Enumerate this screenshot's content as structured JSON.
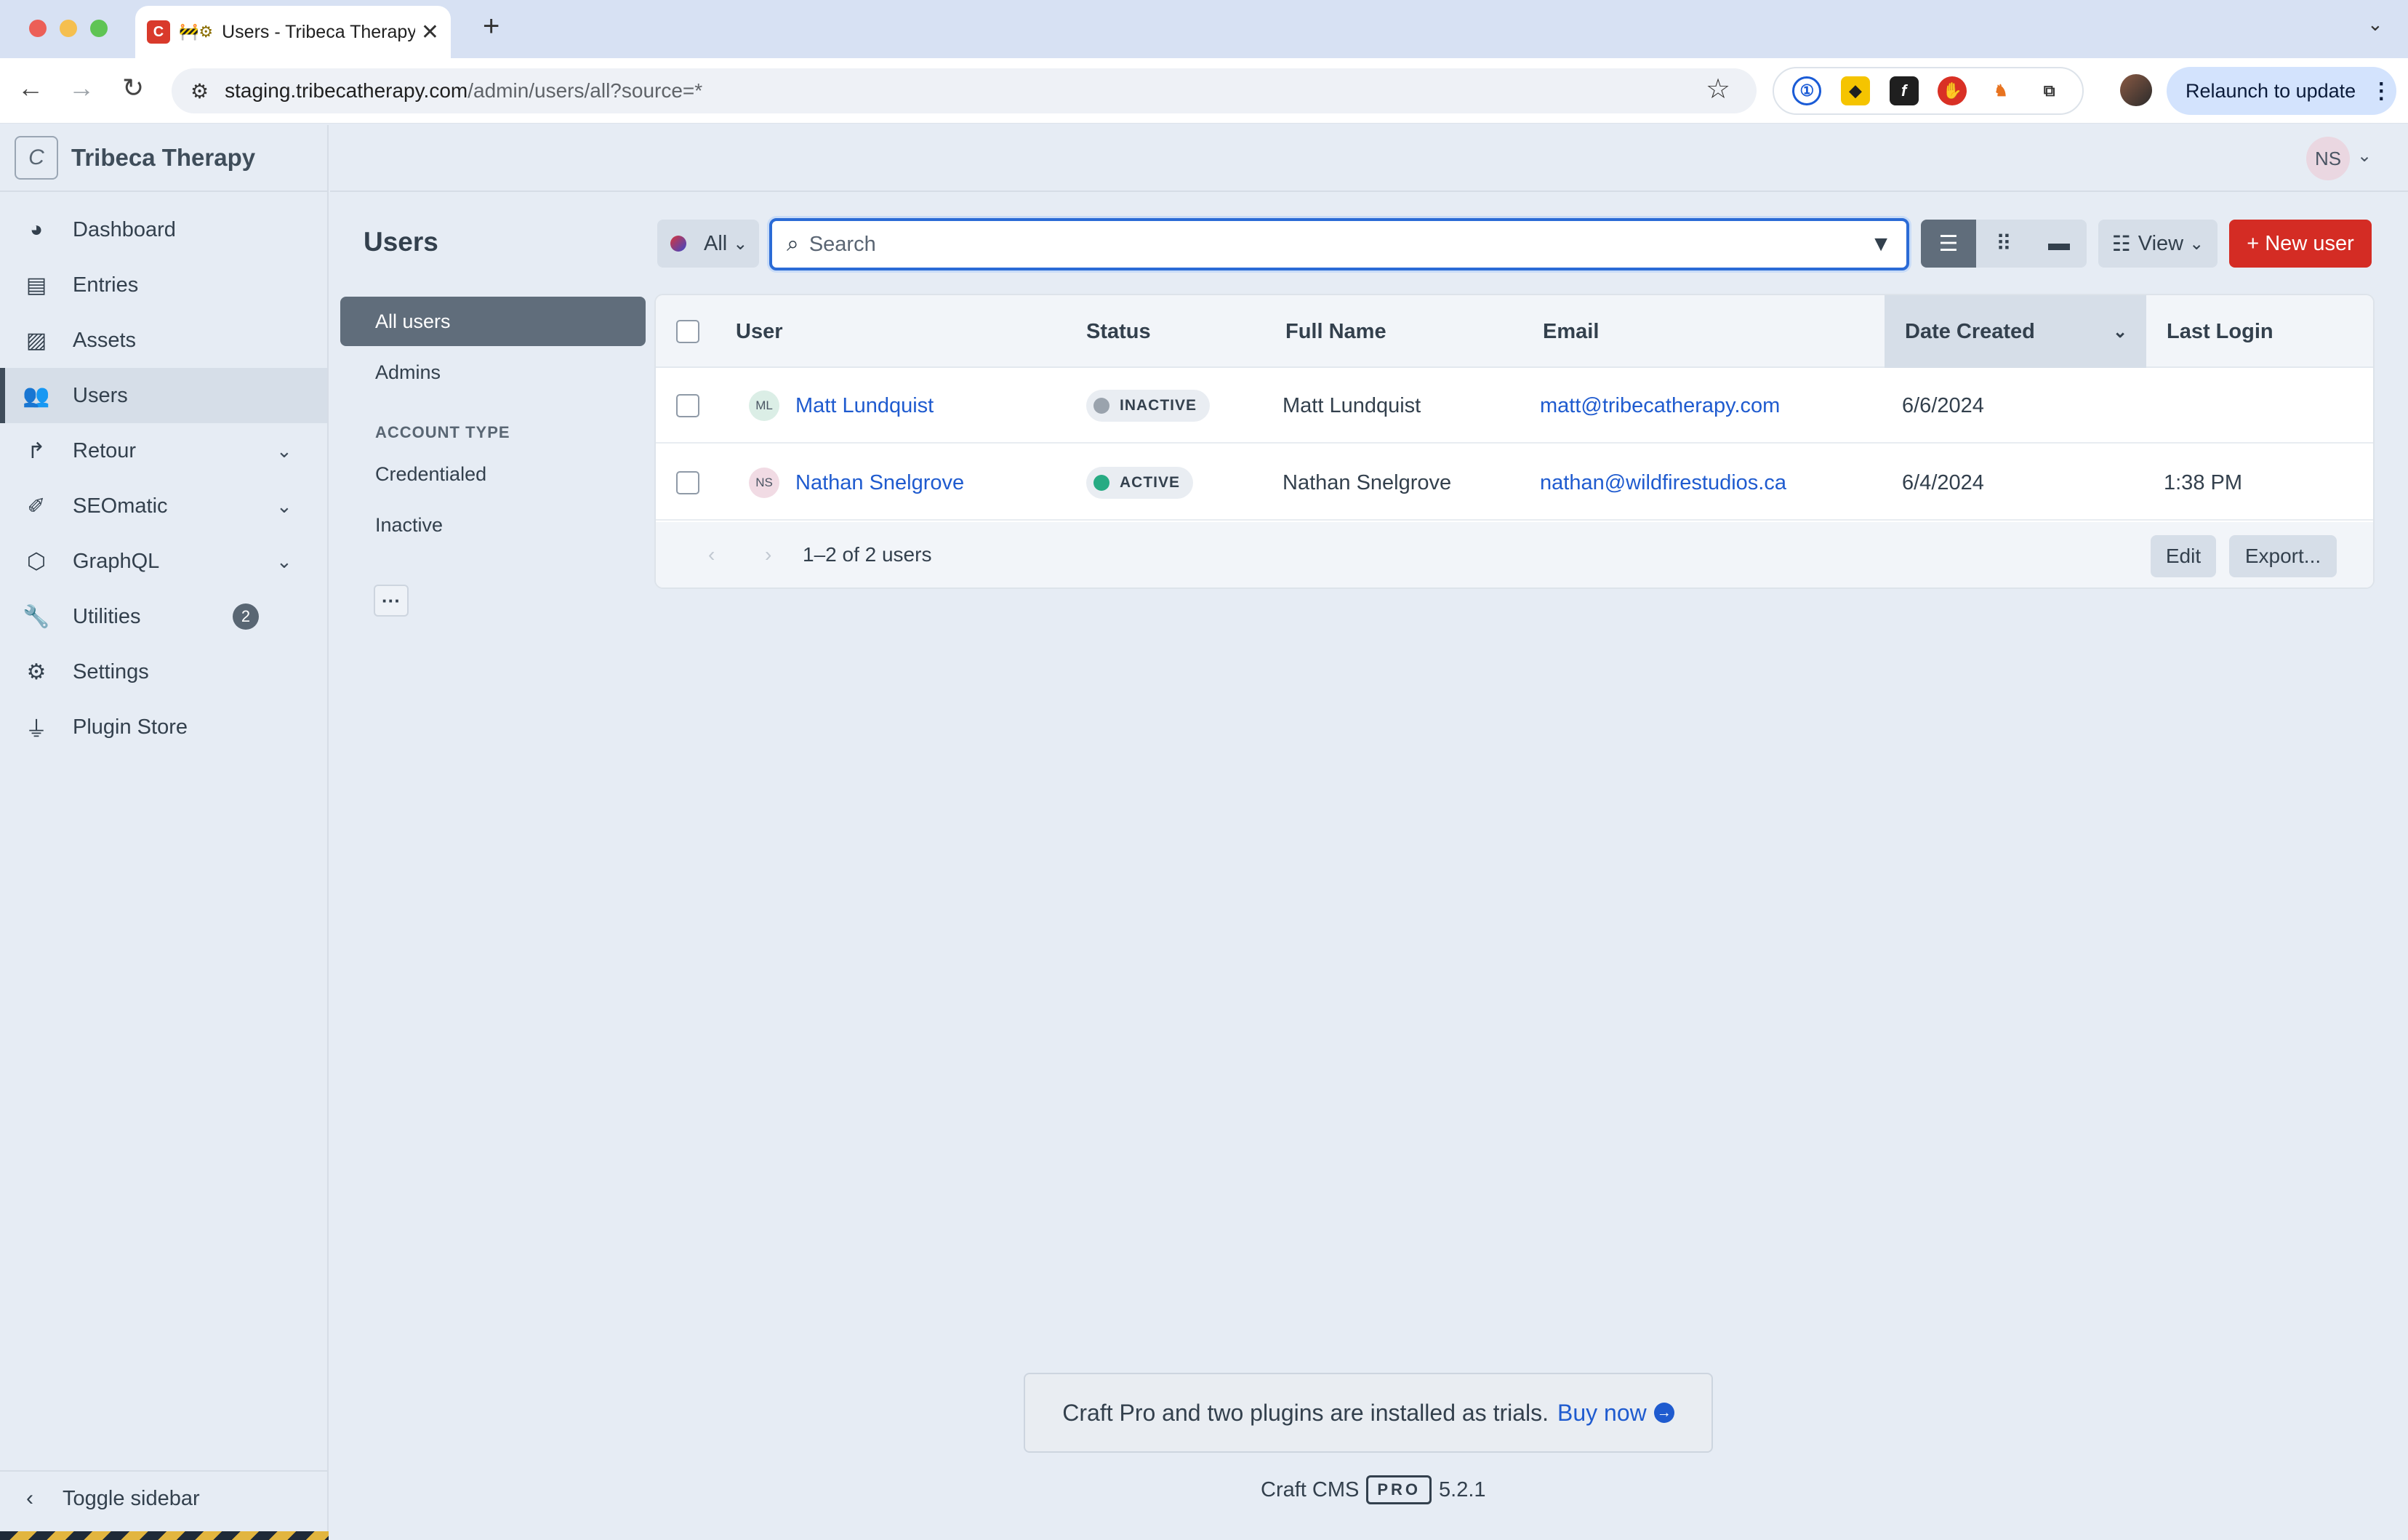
{
  "browser": {
    "tab_title": "Users - Tribeca Therapy",
    "tab_favicon": "C",
    "tab_extra_icons": "🚧⚙",
    "new_tab": "+",
    "url_host": "staging.tribecatherapy.com",
    "url_path": "/admin/users/all?source=*",
    "relaunch_label": "Relaunch to update",
    "extensions": [
      "1password-icon",
      "sentry-icon",
      "font-icon",
      "adblock-icon",
      "fox-icon",
      "puzzle-icon"
    ]
  },
  "site": {
    "logo_letter": "C",
    "name": "Tribeca Therapy"
  },
  "nav": {
    "items": [
      {
        "label": "Dashboard",
        "icon": "dashboard-icon"
      },
      {
        "label": "Entries",
        "icon": "entries-icon"
      },
      {
        "label": "Assets",
        "icon": "assets-icon"
      },
      {
        "label": "Users",
        "icon": "users-icon",
        "selected": true
      },
      {
        "label": "Retour",
        "icon": "retour-icon",
        "expandable": true
      },
      {
        "label": "SEOmatic",
        "icon": "seomatic-icon",
        "expandable": true
      },
      {
        "label": "GraphQL",
        "icon": "graphql-icon",
        "expandable": true
      },
      {
        "label": "Utilities",
        "icon": "wrench-icon",
        "badge": "2"
      },
      {
        "label": "Settings",
        "icon": "gear-icon"
      },
      {
        "label": "Plugin Store",
        "icon": "plug-icon"
      }
    ],
    "toggle_label": "Toggle sidebar"
  },
  "user_menu": {
    "initials": "NS"
  },
  "page": {
    "title": "Users",
    "sources": {
      "all_users": "All users",
      "admins": "Admins",
      "group_heading": "ACCOUNT TYPE",
      "credentialed": "Credentialed",
      "inactive": "Inactive"
    }
  },
  "toolbar": {
    "site_label": "All",
    "search_placeholder": "Search",
    "view_label": "View",
    "new_user_label": "+ New user"
  },
  "table": {
    "columns": [
      "User",
      "Status",
      "Full Name",
      "Email",
      "Date Created",
      "Last Login"
    ],
    "rows": [
      {
        "initials": "ML",
        "user": "Matt Lundquist",
        "status": "INACTIVE",
        "full_name": "Matt Lundquist",
        "email": "matt@tribecatherapy.com",
        "date_created": "6/6/2024",
        "last_login": ""
      },
      {
        "initials": "NS",
        "user": "Nathan Snelgrove",
        "status": "ACTIVE",
        "full_name": "Nathan Snelgrove",
        "email": "nathan@wildfirestudios.ca",
        "date_created": "6/4/2024",
        "last_login": "1:38 PM"
      }
    ],
    "pagination": "1–2 of 2 users",
    "edit_label": "Edit",
    "export_label": "Export..."
  },
  "footer": {
    "trial_text": "Craft Pro and two plugins are installed as trials.",
    "buy_label": "Buy now",
    "cms_name": "Craft CMS",
    "edition": "PRO",
    "version": "5.2.1"
  },
  "colors": {
    "accent_blue": "#2b6bd6",
    "new_user_red": "#d42c24",
    "active_green": "#27ab83",
    "inactive_gray": "#9aa3ad"
  }
}
